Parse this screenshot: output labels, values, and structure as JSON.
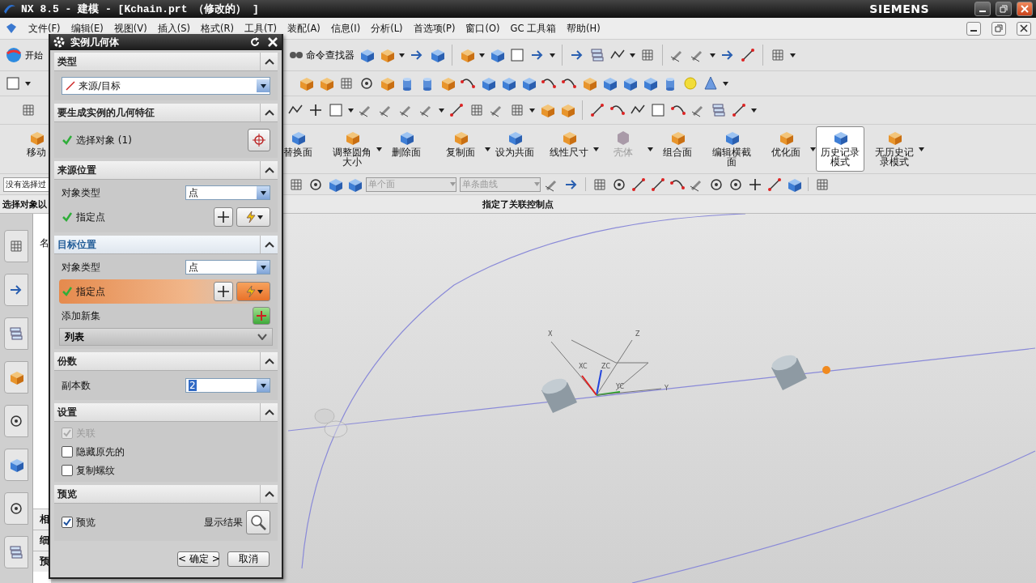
{
  "window": {
    "title": "NX 8.5 - 建模 - [Kchain.prt （修改的） ]",
    "brand": "SIEMENS"
  },
  "menu": [
    "文件(F)",
    "编辑(E)",
    "视图(V)",
    "插入(S)",
    "格式(R)",
    "工具(T)",
    "装配(A)",
    "信息(I)",
    "分析(L)",
    "首选项(P)",
    "窗口(O)",
    "GC 工具箱",
    "帮助(H)"
  ],
  "toolbar": {
    "start": "开始",
    "command_finder": "命令查找器",
    "move": "移动"
  },
  "feature_buttons": [
    {
      "label": "替换面",
      "selected": false,
      "disabled": false,
      "menu": false
    },
    {
      "label": "调整圆角大小",
      "selected": false,
      "disabled": false,
      "menu": true
    },
    {
      "label": "删除面",
      "selected": false,
      "disabled": false,
      "menu": false
    },
    {
      "label": "复制面",
      "selected": false,
      "disabled": false,
      "menu": true
    },
    {
      "label": "设为共面",
      "selected": false,
      "disabled": false,
      "menu": false
    },
    {
      "label": "线性尺寸",
      "selected": false,
      "disabled": false,
      "menu": true
    },
    {
      "label": "壳体",
      "selected": false,
      "disabled": true,
      "menu": true
    },
    {
      "label": "组合面",
      "selected": false,
      "disabled": false,
      "menu": false
    },
    {
      "label": "编辑横截面",
      "selected": false,
      "disabled": false,
      "menu": false
    },
    {
      "label": "优化面",
      "selected": false,
      "disabled": false,
      "menu": true
    },
    {
      "label": "历史记录模式",
      "selected": true,
      "disabled": false,
      "menu": false
    },
    {
      "label": "无历史记录模式",
      "selected": false,
      "disabled": false,
      "menu": true
    }
  ],
  "selection_bar": {
    "filter": "没有选择过",
    "face_rule": "单个面",
    "curve_rule": "单条曲线"
  },
  "cue_line": {
    "prompt": "选择对象以",
    "status": "指定了关联控制点"
  },
  "navigator": {
    "column": "名",
    "panels": [
      "相",
      "细",
      "预"
    ]
  },
  "dialog": {
    "title": "实例几何体",
    "sections": [
      {
        "title": "类型",
        "highlighted": false,
        "rows": [
          {
            "kind": "dropdown",
            "value": "来源/目标"
          }
        ]
      },
      {
        "title": "要生成实例的几何特征",
        "highlighted": false,
        "rows": [
          {
            "kind": "selector",
            "label": "选择对象 (1)",
            "done": true
          }
        ]
      },
      {
        "title": "来源位置",
        "highlighted": false,
        "rows": [
          {
            "kind": "combo",
            "label": "对象类型",
            "value": "点"
          },
          {
            "kind": "point",
            "label": "指定点",
            "done": true,
            "active": false
          }
        ]
      },
      {
        "title": "目标位置",
        "highlighted": true,
        "rows": [
          {
            "kind": "combo",
            "label": "对象类型",
            "value": "点"
          },
          {
            "kind": "point",
            "label": "指定点",
            "done": true,
            "active": true
          },
          {
            "kind": "add",
            "label": "添加新集"
          },
          {
            "kind": "list",
            "label": "列表"
          }
        ]
      },
      {
        "title": "份数",
        "highlighted": false,
        "rows": [
          {
            "kind": "spinner",
            "label": "副本数",
            "value": "2"
          }
        ]
      },
      {
        "title": "设置",
        "highlighted": false,
        "rows": [
          {
            "kind": "checkbox",
            "label": "关联",
            "checked": true,
            "disabled": true
          },
          {
            "kind": "checkbox",
            "label": "隐藏原先的",
            "checked": false,
            "disabled": false
          },
          {
            "kind": "checkbox",
            "label": "复制螺纹",
            "checked": false,
            "disabled": false
          }
        ]
      },
      {
        "title": "预览",
        "highlighted": false,
        "rows": [
          {
            "kind": "preview",
            "label": "预览",
            "checked": true,
            "result_label": "显示结果"
          }
        ]
      }
    ],
    "buttons": [
      "< 确定 >",
      "取消"
    ]
  },
  "viewport": {
    "axis_labels": [
      "X",
      "Z",
      "XC",
      "ZC",
      "YC",
      "Y"
    ]
  }
}
